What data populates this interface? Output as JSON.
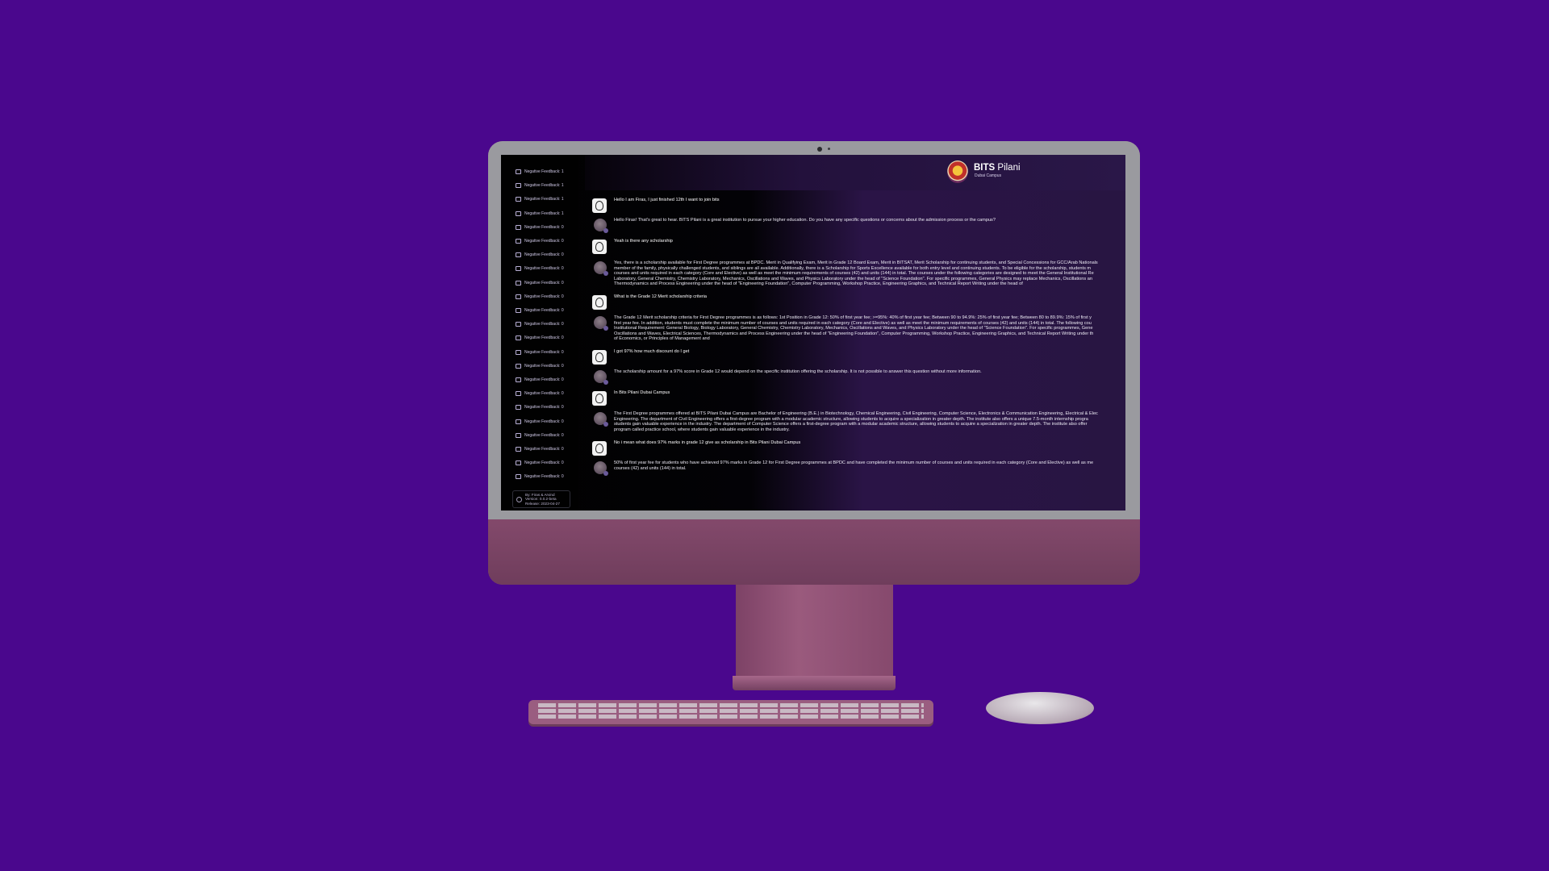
{
  "sidebar": {
    "history": [
      "Negative Feedback: 1",
      "Negative Feedback: 1",
      "Negative Feedback: 1",
      "Negative Feedback: 1",
      "Negative Feedback: 0",
      "Negative Feedback: 0",
      "Negative Feedback: 0",
      "Negative Feedback: 0",
      "Negative Feedback: 0",
      "Negative Feedback: 0",
      "Negative Feedback: 0",
      "Negative Feedback: 0",
      "Negative Feedback: 0",
      "Negative Feedback: 0",
      "Negative Feedback: 0",
      "Negative Feedback: 0",
      "Negative Feedback: 0",
      "Negative Feedback: 0",
      "Negative Feedback: 0",
      "Negative Feedback: 0",
      "Negative Feedback: 0",
      "Negative Feedback: 0",
      "Negative Feedback: 0"
    ],
    "footer": {
      "authors": "By: Firas & Arvind",
      "version": "Version: 0.0.2-beta",
      "release": "Release: 2023-04-27"
    }
  },
  "header": {
    "brand_bold": "BITS",
    "brand_rest": "Pilani",
    "subtitle": "Dubai Campus"
  },
  "messages": [
    {
      "role": "user",
      "lines": [
        "Hello I am Firas, I just finished 12th I want to join bits"
      ]
    },
    {
      "role": "bot",
      "lines": [
        "Hello Firas! That's great to hear. BITS Pilani is a great institution to pursue your higher education. Do you have any specific questions or concerns about the admission process or the campus?"
      ]
    },
    {
      "role": "user",
      "lines": [
        "Yeah is there any scholarship"
      ]
    },
    {
      "role": "bot",
      "lines": [
        "Yes, there is a scholarship available for First Degree programmes at BPDC. Merit in Qualifying Exam, Merit in Grade 12 Board Exam, Merit in BITSAT, Merit Scholarship for continuing students, and Special Concessions for GCC/Arab Nationals",
        "member of the family, physically challenged students, and siblings are all available. Additionally, there is a Scholarship for Sports Excellence available for both entry level and continuing students. To be eligible for the scholarship, students m",
        "courses and units required in each category (Core and Elective) as well as meet the minimum requirements of courses (42) and units (144) in total. The courses under the following categories are designed to meet the General Institutional Re",
        "Laboratory, General Chemistry, Chemistry Laboratory, Mechanics, Oscillations and Waves, and Physics Laboratory under the head of \"Science Foundation\". For specific programmes, General Physics may replace Mechanics, Oscillations an",
        "Thermodynamics and Process Engineering under the head of \"Engineering Foundation\", Computer Programming, Workshop Practice, Engineering Graphics, and Technical Report Writing under the head of"
      ]
    },
    {
      "role": "user",
      "lines": [
        "What is the Grade 12 Merit scholarship criteria"
      ]
    },
    {
      "role": "bot",
      "lines": [
        "The Grade 12 Merit scholarship criteria for First Degree programmes is as follows: 1st Position in Grade 12: 50% of first year fee; >=95%: 40% of first year fee; Between 90 to 94.9%: 25% of first year fee; Between 80 to 89.9%: 15% of first y",
        "first year fee. In addition, students must complete the minimum number of courses and units required in each category (Core and Elective) as well as meet the minimum requirements of courses (42) and units (144) in total. The following cou",
        "Institutional Requirement: General Biology, Biology Laboratory, General Chemistry, Chemistry Laboratory, Mechanics, Oscillations and Waves, and Physics Laboratory under the head of \"Science Foundation\". For specific programmes, Gene",
        "Oscillations and Waves, Electrical Sciences, Thermodynamics and Process Engineering under the head of \"Engineering Foundation\", Computer Programming, Workshop Practice, Engineering Graphics, and Technical Report Writing under th",
        "of Economics, or Principles of Management and"
      ]
    },
    {
      "role": "user",
      "lines": [
        "I got 97% how much discount do I get"
      ]
    },
    {
      "role": "bot",
      "lines": [
        "The scholarship amount for a 97% score in Grade 12 would depend on the specific institution offering the scholarship. It is not possible to answer this question without more information."
      ]
    },
    {
      "role": "user",
      "lines": [
        "In Bits Pilani Dubai Campus"
      ]
    },
    {
      "role": "bot",
      "lines": [
        "The First Degree programmes offered at BITS Pilani Dubai Campus are Bachelor of Engineering (B.E.) in Biotechnology, Chemical Engineering, Civil Engineering, Computer Science, Electronics & Communication Engineering, Electrical & Elec",
        "Engineering. The department of Civil Engineering offers a first-degree program with a modular academic structure, allowing students to acquire a specialization in greater depth. The institute also offers a unique 7.5-month internship progra",
        "students gain valuable experience in the industry. The department of Computer Science offers a first-degree program with a modular academic structure, allowing students to acquire a specialization in greater depth. The institute also offer",
        "program called practice school, where students gain valuable experience in the industry."
      ]
    },
    {
      "role": "user",
      "lines": [
        "No i mean what does 97% marks in grade 12 give as scholarship in Bits Pilani Dubai Campus"
      ]
    },
    {
      "role": "bot",
      "lines": [
        "50% of first year fee for students who have achieved 97% marks in Grade 12 for First Degree programmes at BPDC and have completed the minimum number of courses and units required in each category (Core and Elective) as well as me",
        "courses (42) and units (144) in total."
      ]
    }
  ]
}
